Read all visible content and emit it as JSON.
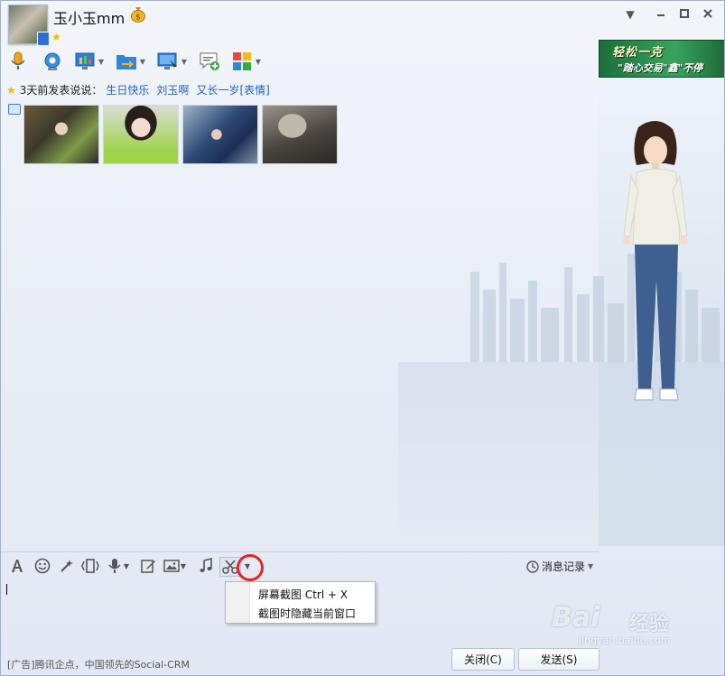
{
  "header": {
    "username": "玉小玉mm",
    "icons": [
      "avatar",
      "phone-online-icon",
      "money-bag-icon",
      "star-icon"
    ]
  },
  "window_controls": [
    "dropdown-icon",
    "minimize-icon",
    "maximize-icon",
    "close-icon"
  ],
  "top_toolbar": [
    "microphone-icon",
    "webcam-icon",
    "screen-share-icon",
    "file-transfer-icon",
    "remote-assist-icon",
    "sms-add-icon",
    "apps-grid-icon"
  ],
  "status": {
    "prefix": "3天前发表说说：",
    "links": [
      "生日快乐",
      "刘玉啊",
      "又长一岁[表情]"
    ]
  },
  "ad_banner": {
    "line1": "轻松一克",
    "line2": "\"踏心交易\"鑫\"不停"
  },
  "bottom_toolbar": [
    "font-icon",
    "emoji-icon",
    "magic-wand-icon",
    "shake-icon",
    "voice-icon",
    "edit-icon",
    "image-icon",
    "music-icon",
    "scissors-icon"
  ],
  "history_label": "消息记录",
  "screenshot_menu": {
    "items": [
      "屏幕截图 Ctrl + X",
      "截图时隐藏当前窗口"
    ]
  },
  "footer": {
    "ad_text": "[广告]腾讯企点，中国领先的Social-CRM",
    "close_label": "关闭(C)",
    "send_label": "发送(S)"
  },
  "watermark": {
    "brand": "Bai",
    "cn": "经验",
    "url": "jingyan.baidu.com"
  },
  "colors": {
    "link": "#1e62c7",
    "highlight_circle": "#e5242a",
    "ad_green": "#38a35f"
  }
}
